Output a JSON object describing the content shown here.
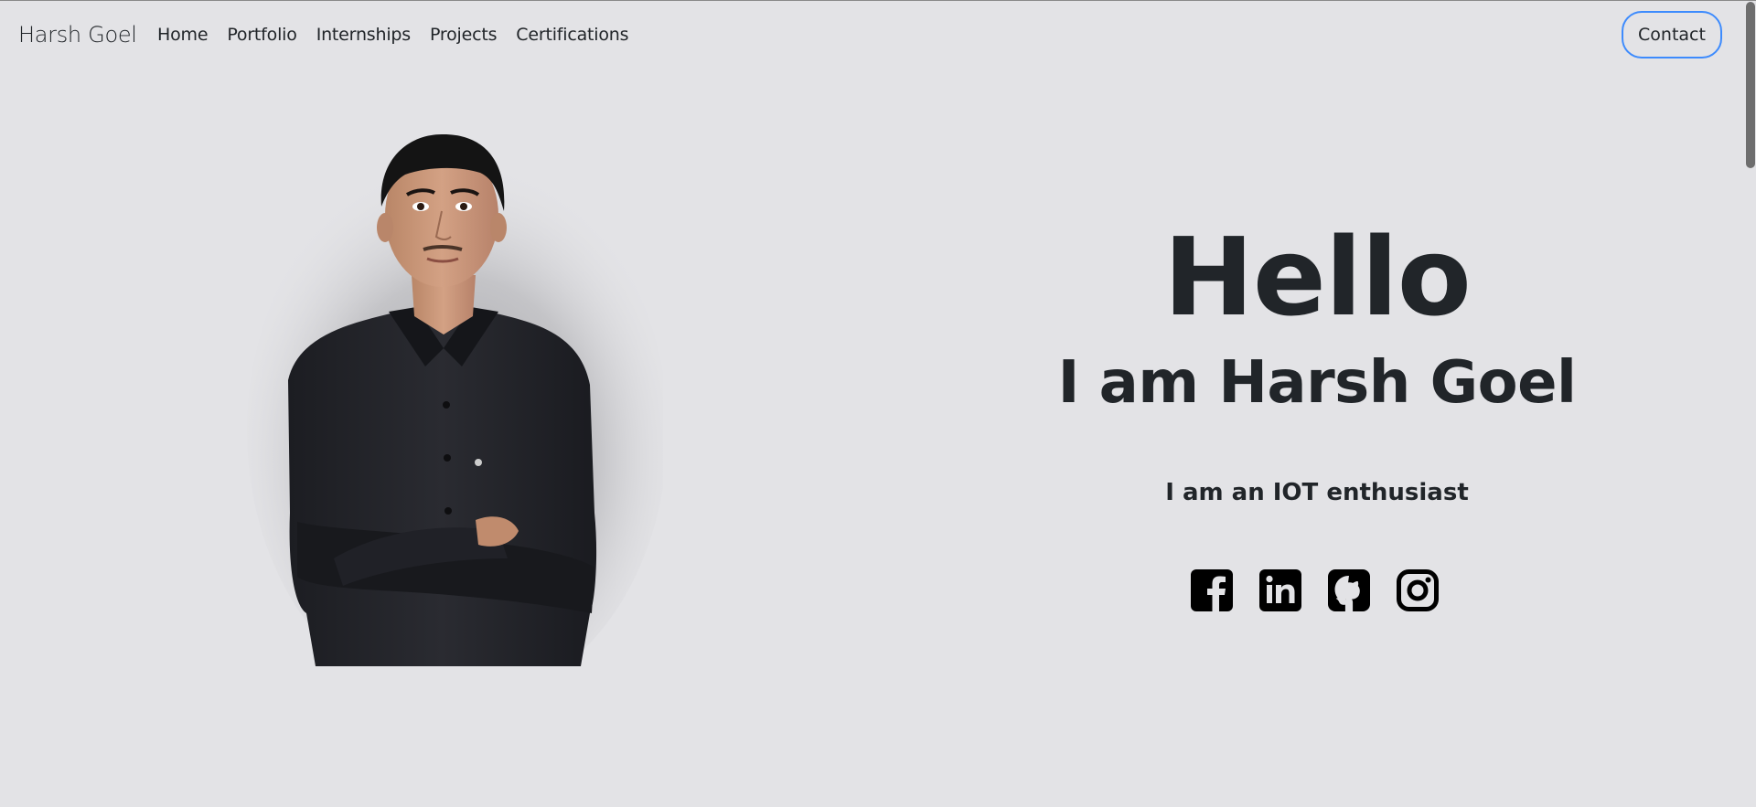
{
  "navbar": {
    "brand": "Harsh Goel",
    "links": [
      "Home",
      "Portfolio",
      "Internships",
      "Projects",
      "Certifications"
    ],
    "contact": "Contact"
  },
  "hero": {
    "greeting": "Hello",
    "name": "I am Harsh Goel",
    "tagline": "I am an IOT enthusiast"
  },
  "socials": [
    "facebook-icon",
    "linkedin-icon",
    "github-icon",
    "instagram-icon"
  ],
  "colors": {
    "background": "#e3e3e6",
    "text": "#212529",
    "contact_border": "#3d8bfd"
  }
}
